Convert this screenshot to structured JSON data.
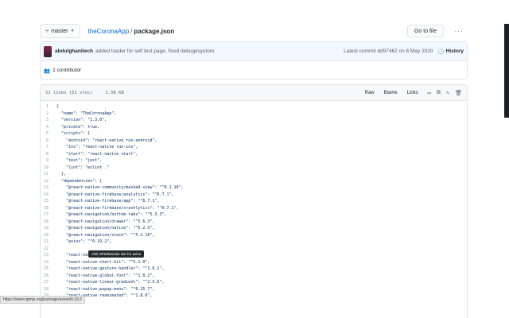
{
  "topbar": {
    "branch": "master",
    "repo": "theCoronaApp",
    "separator": "/",
    "file": "package.json",
    "goto_label": "Go to file",
    "more_label": "···"
  },
  "commit": {
    "author": "abdulghanitech",
    "message": "added loader for self test page, fixed debugesystore",
    "latest": "Latest commit dd97462 on 6 May 2020",
    "history_label": "History",
    "contributors": "1 contributor"
  },
  "file_header": {
    "lines": "51 lines (51 sloc)",
    "size": "1.58 KB",
    "raw_label": "Raw",
    "blame_label": "Blame",
    "links_label": "Links"
  },
  "code_lines": [
    {
      "n": "1",
      "t": "{"
    },
    {
      "n": "2",
      "t": "  \"name\": \"TheCoronaApp\","
    },
    {
      "n": "3",
      "t": "  \"version\": \"1.3.0\","
    },
    {
      "n": "4",
      "t": "  \"private\": true,"
    },
    {
      "n": "5",
      "t": "  \"scripts\": {"
    },
    {
      "n": "6",
      "t": "    \"android\": \"react-native run-android\","
    },
    {
      "n": "7",
      "t": "    \"ios\": \"react-native run-ios\","
    },
    {
      "n": "8",
      "t": "    \"start\": \"react-native start\","
    },
    {
      "n": "9",
      "t": "    \"test\": \"jest\","
    },
    {
      "n": "10",
      "t": "    \"lint\": \"eslint .\""
    },
    {
      "n": "11",
      "t": "  },"
    },
    {
      "n": "12",
      "t": "  \"dependencies\": {"
    },
    {
      "n": "13",
      "t": "    \"@react-native-community/masked-view\": \"^0.1.10\","
    },
    {
      "n": "14",
      "t": "    \"@react-native-firebase/analytics\": \"^6.7.1\","
    },
    {
      "n": "15",
      "t": "    \"@react-native-firebase/app\": \"^6.7.1\","
    },
    {
      "n": "16",
      "t": "    \"@react-native-firebase/crashlytics\": \"^6.7.1\","
    },
    {
      "n": "17",
      "t": "    \"@react-navigation/bottom-tabs\": \"^5.3.3\","
    },
    {
      "n": "18",
      "t": "    \"@react-navigation/drawer\": \"^5.6.3\","
    },
    {
      "n": "19",
      "t": "    \"@react-navigation/native\": \"^5.2.3\","
    },
    {
      "n": "20",
      "t": "    \"@react-navigation/stack\": \"^5.2.18\","
    },
    {
      "n": "21",
      "t": "    \"axios\": \"^0.19.2\","
    },
    {
      "n": "22",
      "t": ""
    },
    {
      "n": "23",
      "t": "    \"react-native\": \"0.62.2\","
    },
    {
      "n": "24",
      "t": "    \"react-native-chart-kit\": \"^5.1.0\","
    },
    {
      "n": "25",
      "t": "    \"react-native-gesture-handler\": \"^1.6.1\","
    },
    {
      "n": "26",
      "t": "    \"react-native-global-font\": \"^1.0.2\","
    },
    {
      "n": "27",
      "t": "    \"react-native-linear-gradient\": \"^2.5.6\","
    },
    {
      "n": "28",
      "t": "    \"react-native-popup-menu\": \"^0.15.7\","
    },
    {
      "n": "29",
      "t": "    \"react-native-reanimated\": \"^1.8.0\","
    }
  ],
  "tooltip": "Visit NPM/Module site for axios",
  "status_url": "https://www.npmjs.org/package/axios#0.19.2"
}
